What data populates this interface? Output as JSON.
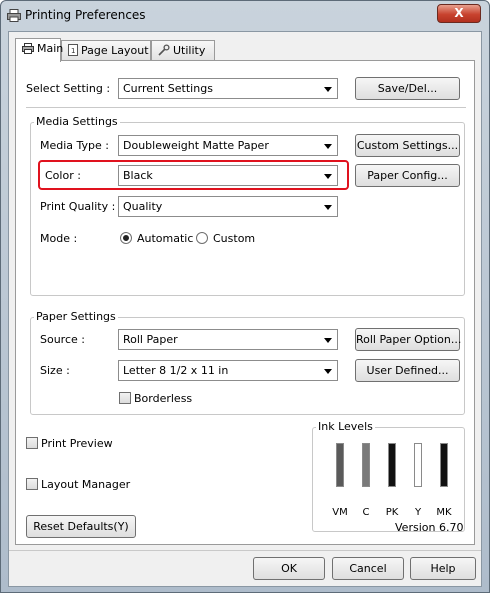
{
  "window": {
    "title": "Printing Preferences",
    "close_label": "X"
  },
  "tabs": [
    {
      "label": "Main",
      "icon": "printer-icon"
    },
    {
      "label": "Page Layout",
      "icon": "page-icon"
    },
    {
      "label": "Utility",
      "icon": "wrench-icon"
    }
  ],
  "select_setting": {
    "label": "Select Setting :",
    "value": "Current Settings",
    "button": "Save/Del..."
  },
  "media_settings": {
    "title": "Media Settings",
    "media_type_label": "Media Type :",
    "media_type_value": "Doubleweight Matte Paper",
    "custom_button": "Custom Settings...",
    "color_label": "Color :",
    "color_value": "Black",
    "paper_config_button": "Paper Config...",
    "print_quality_label": "Print Quality :",
    "print_quality_value": "Quality",
    "mode_label": "Mode :",
    "mode_automatic": "Automatic",
    "mode_custom": "Custom",
    "mode_selected": "Automatic"
  },
  "paper_settings": {
    "title": "Paper Settings",
    "source_label": "Source :",
    "source_value": "Roll Paper",
    "roll_button": "Roll Paper Option...",
    "size_label": "Size :",
    "size_value": "Letter 8 1/2 x 11 in",
    "user_defined_button": "User Defined...",
    "borderless_label": "Borderless",
    "borderless_checked": false
  },
  "print_preview": {
    "label": "Print Preview",
    "checked": false
  },
  "layout_manager": {
    "label": "Layout Manager",
    "checked": false
  },
  "ink_levels": {
    "title": "Ink Levels",
    "inks": [
      {
        "name": "VM",
        "level": 1.0,
        "color": "#5a5a5a"
      },
      {
        "name": "C",
        "level": 1.0,
        "color": "#7a7a7a"
      },
      {
        "name": "PK",
        "level": 1.0,
        "color": "#111111"
      },
      {
        "name": "Y",
        "level": 0.0,
        "color": "#d8d8d8"
      },
      {
        "name": "MK",
        "level": 1.0,
        "color": "#111111"
      }
    ]
  },
  "footer": {
    "reset_button": "Reset Defaults(Y)",
    "version": "Version 6.70"
  },
  "dialog_buttons": {
    "ok": "OK",
    "cancel": "Cancel",
    "help": "Help"
  },
  "colors": {
    "highlight": "#e0121e",
    "close_button": "#c8432f"
  }
}
